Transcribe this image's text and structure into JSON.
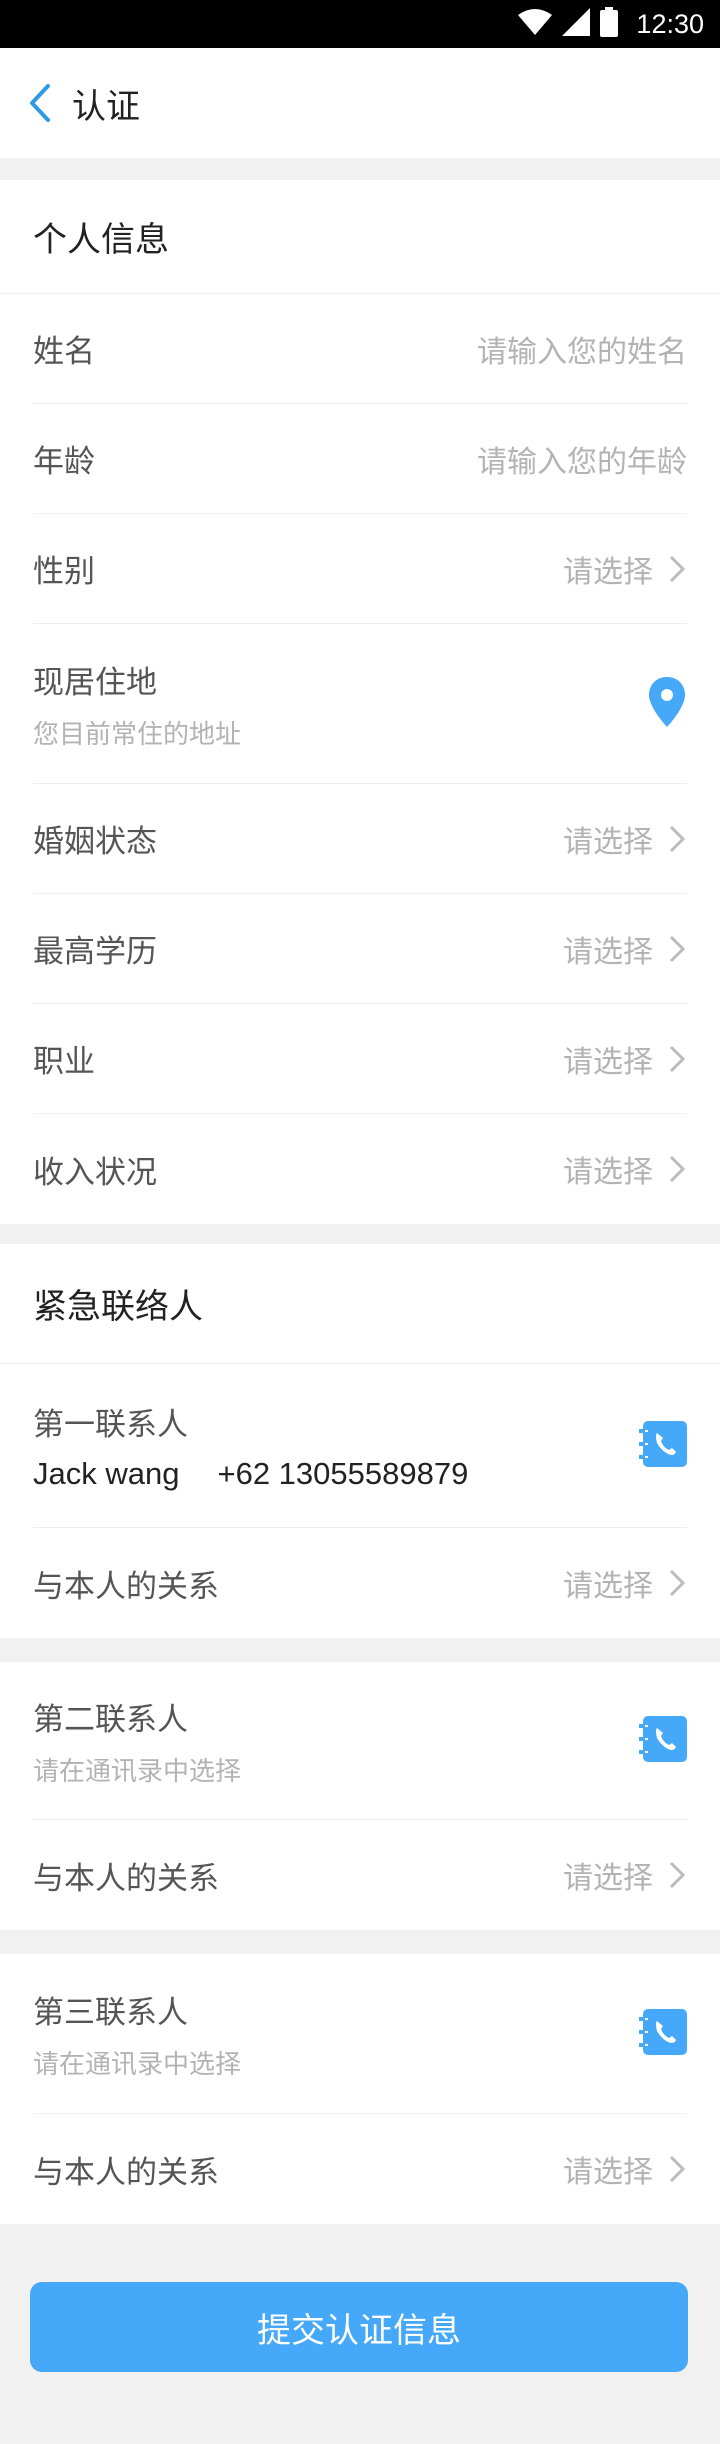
{
  "status_bar": {
    "time": "12:30",
    "wifi_icon": "wifi-icon",
    "signal_icon": "signal-icon",
    "battery_icon": "battery-icon"
  },
  "header": {
    "title": "认证",
    "back_icon": "chevron-left-icon"
  },
  "personal": {
    "title": "个人信息",
    "name": {
      "label": "姓名",
      "placeholder": "请输入您的姓名"
    },
    "age": {
      "label": "年龄",
      "placeholder": "请输入您的年龄"
    },
    "gender": {
      "label": "性别",
      "value": "请选择"
    },
    "residence": {
      "label": "现居住地",
      "hint": "您目前常住的地址",
      "icon": "location-pin-icon"
    },
    "marital": {
      "label": "婚姻状态",
      "value": "请选择"
    },
    "education": {
      "label": "最高学历",
      "value": "请选择"
    },
    "occupation": {
      "label": "职业",
      "value": "请选择"
    },
    "income": {
      "label": "收入状况",
      "value": "请选择"
    }
  },
  "emergency": {
    "title": "紧急联络人",
    "contacts": [
      {
        "label": "第一联系人",
        "name": "Jack wang",
        "phone": "+62 13055589879",
        "relation_label": "与本人的关系",
        "relation_value": "请选择"
      },
      {
        "label": "第二联系人",
        "hint": "请在通讯录中选择",
        "relation_label": "与本人的关系",
        "relation_value": "请选择"
      },
      {
        "label": "第三联系人",
        "hint": "请在通讯录中选择",
        "relation_label": "与本人的关系",
        "relation_value": "请选择"
      }
    ]
  },
  "colors": {
    "accent": "#45a8f8",
    "background": "#f1f1f1",
    "placeholder": "#b3b3b3"
  },
  "submit": {
    "label": "提交认证信息"
  }
}
